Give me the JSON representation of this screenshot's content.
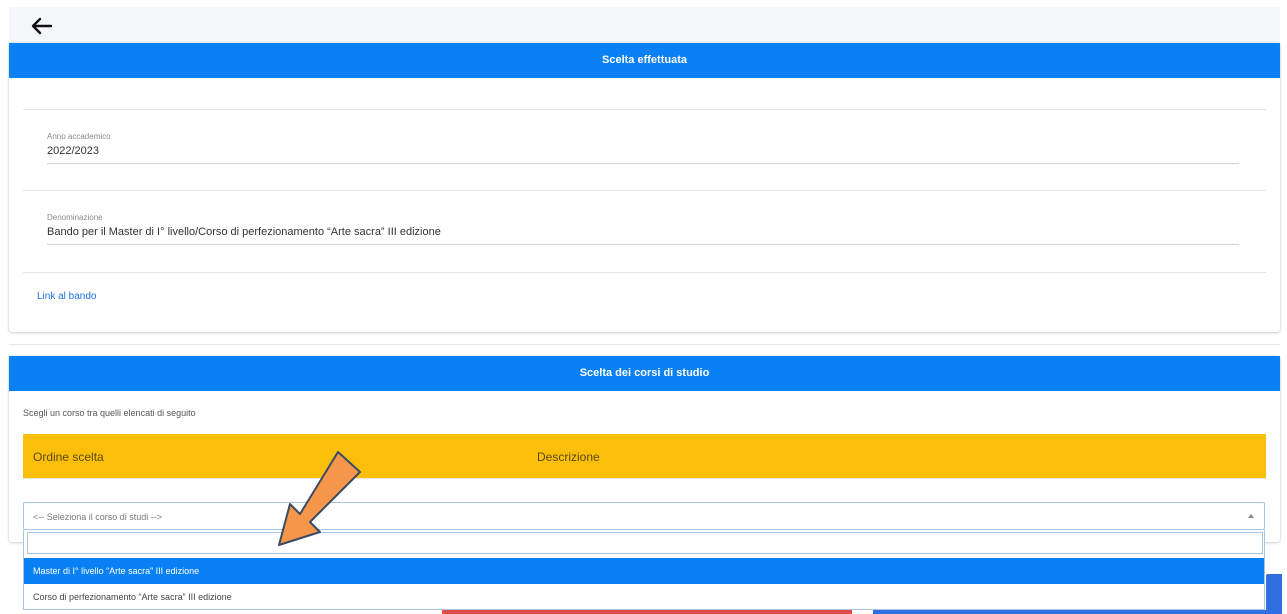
{
  "card1": {
    "header": "Scelta effettuata",
    "anno": {
      "label": "Anno accademico",
      "value": "2022/2023"
    },
    "denominazione": {
      "label": "Denominazione",
      "value": "Bando per il Master di I° livello/Corso di perfezionamento “Arte sacra” III edizione"
    },
    "link": "Link al bando"
  },
  "card2": {
    "header": "Scelta dei corsi di studio",
    "intro": "Scegli un corso tra quelli elencati di seguito",
    "columns": [
      "Ordine scelta",
      "Descrizione"
    ]
  },
  "select": {
    "placeholder": "<-- Seleziona il corso di studi -->",
    "search_value": "",
    "options": [
      "Master di I° livello “Arte sacra” III edizione",
      "Corso di perfezionamento “Arte sacra” III edizione"
    ],
    "highlighted_index": 0
  },
  "colors": {
    "header_blue": "#0a80f5",
    "table_header_yellow": "#fbbf0b",
    "annotation_arrow": "#f5964a"
  },
  "icons": {
    "back": "arrow-left-icon",
    "caret": "caret-up-icon",
    "annotation": "annotation-arrow"
  }
}
